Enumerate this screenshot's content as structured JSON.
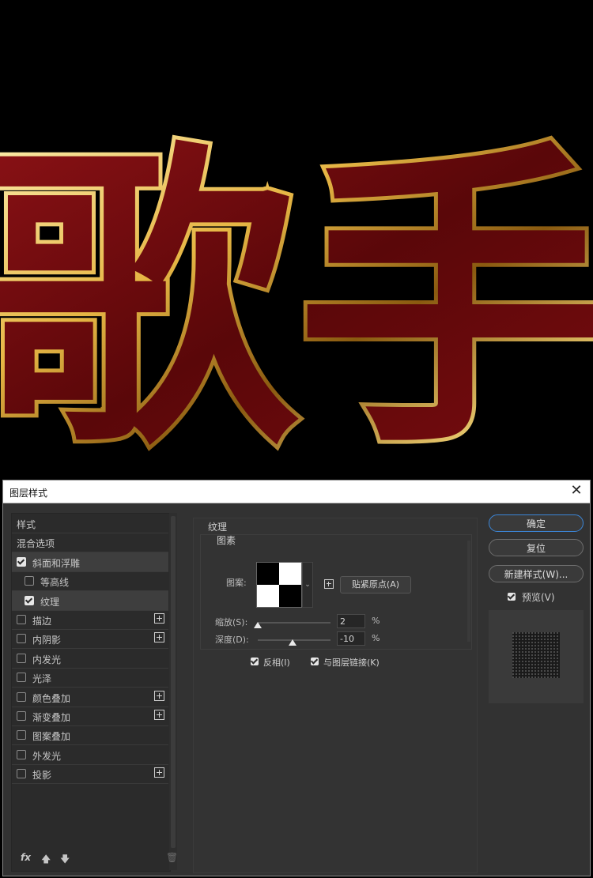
{
  "artwork": {
    "characters": "歌手",
    "colors": {
      "background": "#000000",
      "fill": "#6b0a0c",
      "gold_light": "#f7e08a",
      "gold_dark": "#8a5a10"
    }
  },
  "dialog": {
    "title": "图层样式",
    "close_icon": "close-icon",
    "style_list": [
      {
        "label": "样式",
        "checkbox": false,
        "checked": false,
        "plus": false,
        "indent": false,
        "selected": false
      },
      {
        "label": "混合选项",
        "checkbox": false,
        "checked": false,
        "plus": false,
        "indent": false,
        "selected": false
      },
      {
        "label": "斜面和浮雕",
        "checkbox": true,
        "checked": true,
        "plus": false,
        "indent": false,
        "selected": true
      },
      {
        "label": "等高线",
        "checkbox": true,
        "checked": false,
        "plus": false,
        "indent": true,
        "selected": false
      },
      {
        "label": "纹理",
        "checkbox": true,
        "checked": true,
        "plus": false,
        "indent": true,
        "selected": true
      },
      {
        "label": "描边",
        "checkbox": true,
        "checked": false,
        "plus": true,
        "indent": false,
        "selected": false
      },
      {
        "label": "内阴影",
        "checkbox": true,
        "checked": false,
        "plus": true,
        "indent": false,
        "selected": false
      },
      {
        "label": "内发光",
        "checkbox": true,
        "checked": false,
        "plus": false,
        "indent": false,
        "selected": false
      },
      {
        "label": "光泽",
        "checkbox": true,
        "checked": false,
        "plus": false,
        "indent": false,
        "selected": false
      },
      {
        "label": "颜色叠加",
        "checkbox": true,
        "checked": false,
        "plus": true,
        "indent": false,
        "selected": false
      },
      {
        "label": "渐变叠加",
        "checkbox": true,
        "checked": false,
        "plus": true,
        "indent": false,
        "selected": false
      },
      {
        "label": "图案叠加",
        "checkbox": true,
        "checked": false,
        "plus": false,
        "indent": false,
        "selected": false
      },
      {
        "label": "外发光",
        "checkbox": true,
        "checked": false,
        "plus": false,
        "indent": false,
        "selected": false
      },
      {
        "label": "投影",
        "checkbox": true,
        "checked": false,
        "plus": true,
        "indent": false,
        "selected": false
      }
    ],
    "footer": {
      "fx": "fx",
      "up_icon": "arrow-up-icon",
      "down_icon": "arrow-down-icon",
      "trash_icon": "trash-icon"
    },
    "texture": {
      "section_title": "纹理",
      "group_title": "图素",
      "pattern_label": "图案:",
      "snap_button": "贴紧原点(A)",
      "scale_label": "缩放(S):",
      "scale_value": "2",
      "depth_label": "深度(D):",
      "depth_value": "-10",
      "percent": "%",
      "scale_fraction": 0.0,
      "depth_fraction": 0.48,
      "invert_label": "反相(I)",
      "invert_checked": true,
      "link_label": "与图层链接(K)",
      "link_checked": true
    },
    "buttons": {
      "ok": "确定",
      "reset": "复位",
      "new_style": "新建样式(W)...",
      "preview_label": "预览(V)",
      "preview_checked": true
    }
  }
}
